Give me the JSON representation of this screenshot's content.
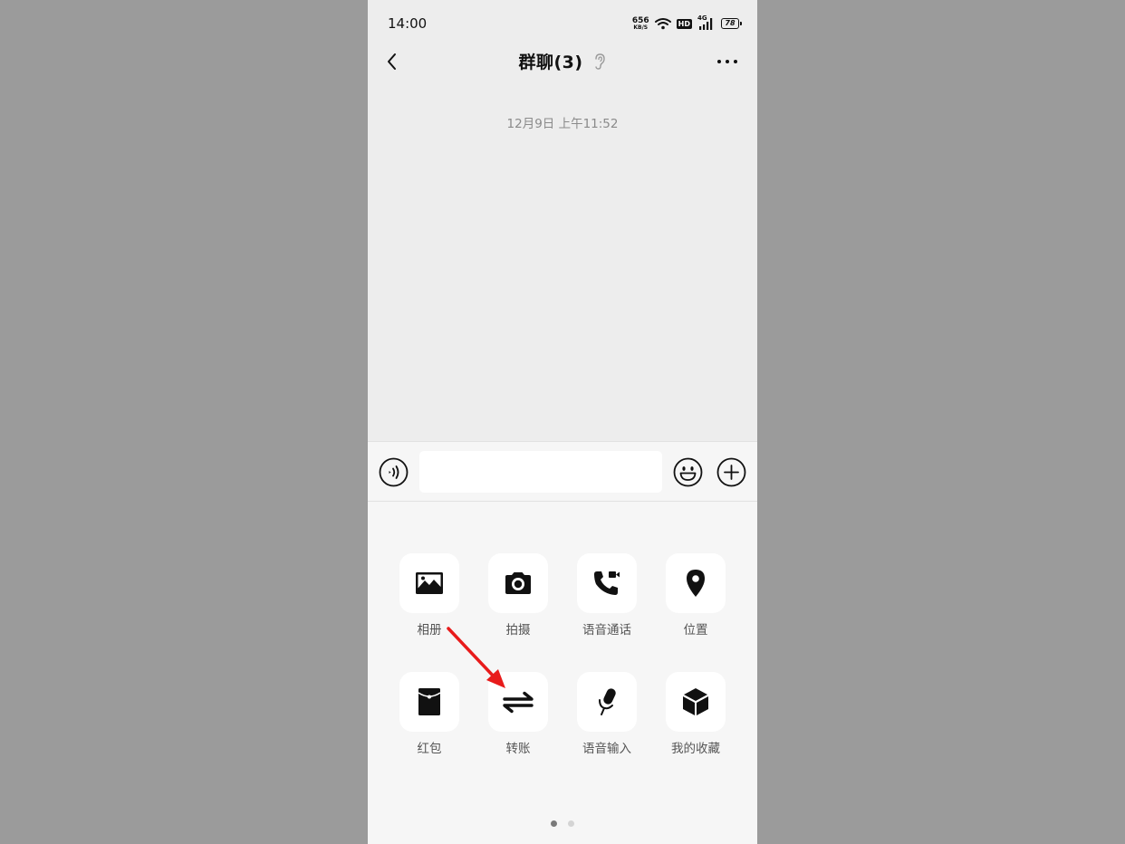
{
  "status_bar": {
    "time": "14:00",
    "net_speed_value": "656",
    "net_speed_unit": "KB/S",
    "hd_label": "HD",
    "signal_label": "4G",
    "battery_level": "78"
  },
  "nav": {
    "title": "群聊(3)"
  },
  "chat": {
    "timestamp": "12月9日 上午11:52"
  },
  "input": {
    "value": ""
  },
  "panel": {
    "items": [
      {
        "label": "相册",
        "icon": "photo-album-icon"
      },
      {
        "label": "拍摄",
        "icon": "camera-icon"
      },
      {
        "label": "语音通话",
        "icon": "voice-call-icon"
      },
      {
        "label": "位置",
        "icon": "location-pin-icon"
      },
      {
        "label": "红包",
        "icon": "red-packet-icon"
      },
      {
        "label": "转账",
        "icon": "transfer-icon"
      },
      {
        "label": "语音输入",
        "icon": "voice-input-icon"
      },
      {
        "label": "我的收藏",
        "icon": "favorites-icon"
      }
    ],
    "page_count": 2,
    "active_page": 1
  },
  "colors": {
    "background_outer": "#9b9b9b",
    "chat_background": "#ededed",
    "panel_background": "#f6f6f6",
    "annotation_arrow": "#e81b1b"
  }
}
